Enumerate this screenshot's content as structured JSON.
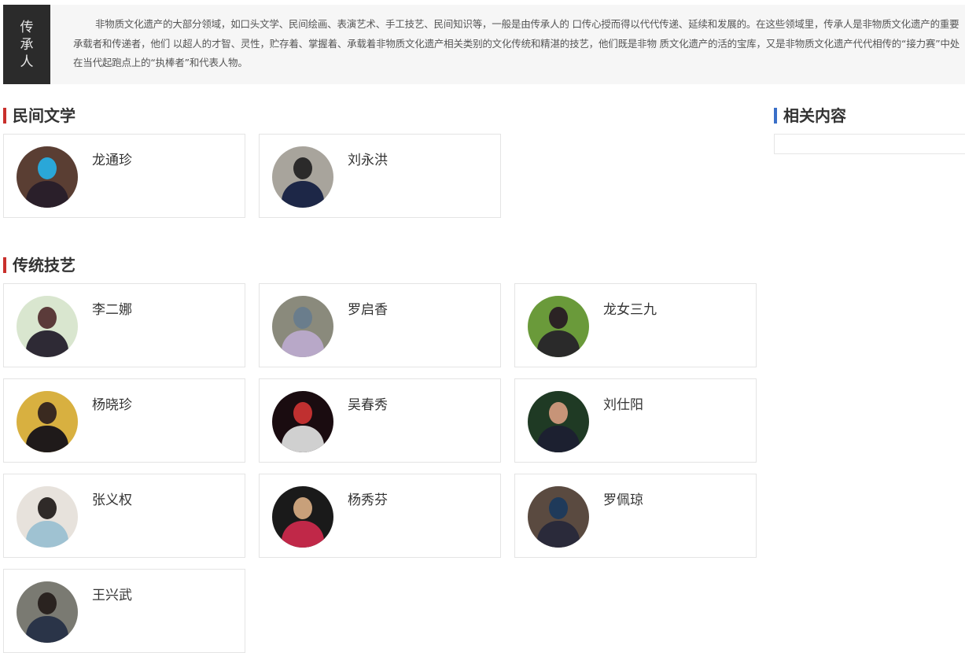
{
  "intro": {
    "label": "传承人",
    "text": "非物质文化遗产的大部分领域，如口头文学、民间绘画、表演艺术、手工技艺、民间知识等，一般是由传承人的 口传心授而得以代代传递、延续和发展的。在这些领域里，传承人是非物质文化遗产的重要承载者和传递者，他们 以超人的才智、灵性，贮存着、掌握着、承载着非物质文化遗产相关类别的文化传统和精湛的技艺，他们既是非物 质文化遗产的活的宝库，又是非物质文化遗产代代相传的“接力赛”中处在当代起跑点上的“执棒者”和代表人物。"
  },
  "sections": {
    "folk_literature": {
      "title": "民间文学",
      "bar_color": "#c9302c",
      "people": [
        {
          "name": "龙通珍",
          "bg": "#5a3e33",
          "head": "#2aa7d8",
          "body": "#2a1f2a"
        },
        {
          "name": "刘永洪",
          "bg": "#a8a49c",
          "head": "#2b2a2a",
          "body": "#1d2747"
        }
      ]
    },
    "traditional_crafts": {
      "title": "传统技艺",
      "bar_color": "#c9302c",
      "people": [
        {
          "name": "李二娜",
          "bg": "#d9e6cf",
          "head": "#5b3b3a",
          "body": "#2e2a35"
        },
        {
          "name": "罗启香",
          "bg": "#8a8a7c",
          "head": "#6a7d8c",
          "body": "#b8a8c8"
        },
        {
          "name": "龙女三九",
          "bg": "#6a9a3a",
          "head": "#2b2324",
          "body": "#2a2a2a"
        },
        {
          "name": "杨晓珍",
          "bg": "#d8b040",
          "head": "#3a2a20",
          "body": "#1f1a1a"
        },
        {
          "name": "吴春秀",
          "bg": "#1a0c10",
          "head": "#c03030",
          "body": "#d0d0d0"
        },
        {
          "name": "刘仕阳",
          "bg": "#1f3a24",
          "head": "#c79478",
          "body": "#1c2030"
        },
        {
          "name": "张义权",
          "bg": "#e7e2dc",
          "head": "#2f2a28",
          "body": "#9fc2d2"
        },
        {
          "name": "杨秀芬",
          "bg": "#1a1a1a",
          "head": "#c8a07a",
          "body": "#c02848"
        },
        {
          "name": "罗佩琼",
          "bg": "#5a4a40",
          "head": "#1f3a5a",
          "body": "#2a2a3a"
        },
        {
          "name": "王兴武",
          "bg": "#7a7a72",
          "head": "#2a2320",
          "body": "#2a3448"
        }
      ]
    },
    "related": {
      "title": "相关内容",
      "bar_color": "#3a6fc8"
    }
  }
}
